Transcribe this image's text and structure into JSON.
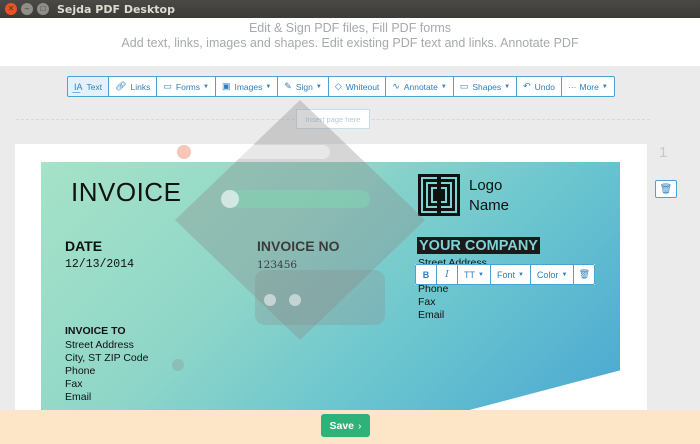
{
  "window": {
    "title": "Sejda PDF Desktop"
  },
  "header": {
    "line1": "Edit & Sign PDF files, Fill PDF forms",
    "line2": "Add text, links, images and shapes. Edit existing PDF text and links. Annotate PDF"
  },
  "toolbar": {
    "text": "Text",
    "links": "Links",
    "forms": "Forms",
    "images": "Images",
    "sign": "Sign",
    "whiteout": "Whiteout",
    "annotate": "Annotate",
    "shapes": "Shapes",
    "undo": "Undo",
    "more": "More"
  },
  "insert_page": "Insert page here",
  "page_number": "1",
  "invoice": {
    "title": "INVOICE",
    "date_label": "DATE",
    "date_value": "12/13/2014",
    "invoice_no_label": "INVOICE NO",
    "invoice_no_value": "123456",
    "logo_line1": "Logo",
    "logo_line2": "Name",
    "company_name": "YOUR COMPANY",
    "company_address": [
      "Street Address",
      "Phone",
      "Fax",
      "Email"
    ],
    "invoice_to_label": "INVOICE TO",
    "invoice_to_lines": [
      "Street Address",
      "City, ST ZIP Code",
      "Phone",
      "Fax",
      "Email"
    ]
  },
  "format_bar": {
    "bold": "B",
    "italic": "I",
    "size": "TT",
    "font": "Font",
    "color": "Color"
  },
  "save": {
    "label": "Save"
  },
  "colors": {
    "accent": "#2f7fc0",
    "save": "#2eb27a",
    "savebar": "#fde5c8"
  }
}
